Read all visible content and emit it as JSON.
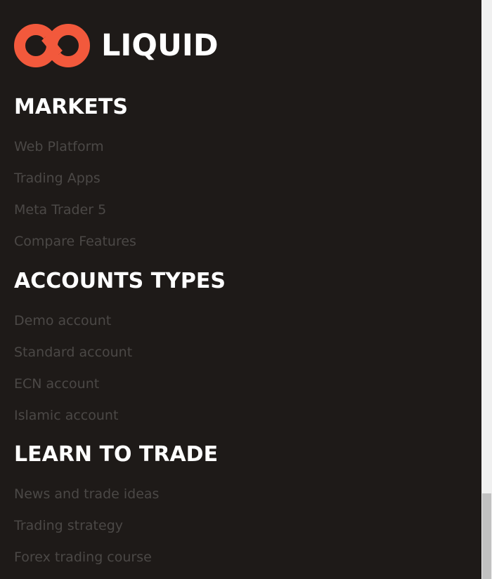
{
  "brand": {
    "name": "LIQUID",
    "accent_color": "#f2593c",
    "logo_icon": "infinity-icon"
  },
  "colors": {
    "background": "#1e1a18",
    "heading": "#ffffff",
    "link": "#4b4846"
  },
  "sections": [
    {
      "title": "MARKETS",
      "links": [
        "Web Platform",
        "Trading Apps",
        "Meta Trader 5",
        "Compare Features"
      ]
    },
    {
      "title": "ACCOUNTS TYPES",
      "links": [
        "Demo account",
        "Standard account",
        "ECN account",
        "Islamic account"
      ]
    },
    {
      "title": "LEARN TO TRADE",
      "links": [
        "News and trade ideas",
        "Trading strategy",
        "Forex trading course"
      ]
    }
  ]
}
